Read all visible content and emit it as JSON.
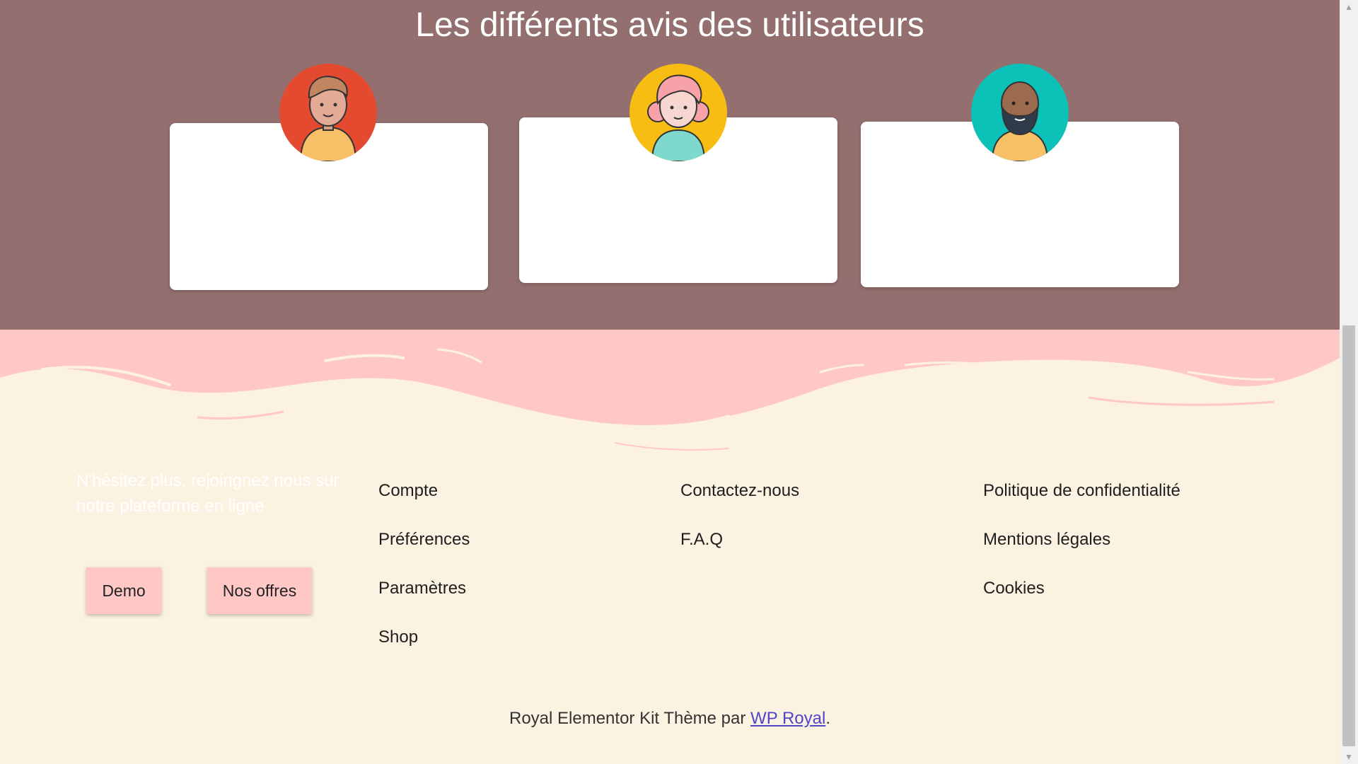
{
  "testimonials": {
    "title": "Les différents avis des utilisateurs",
    "cards": [
      {
        "accent": "#e44a2f",
        "avatar": "man-glasses-avatar-icon"
      },
      {
        "accent": "#f8bd13",
        "avatar": "woman-pink-hair-avatar-icon"
      },
      {
        "accent": "#0cc1b7",
        "avatar": "bearded-man-avatar-icon"
      }
    ]
  },
  "footer": {
    "cta_text": "N'hésitez plus, rejoingnez nous sur notre plateforme en ligne",
    "buttons": {
      "demo": "Demo",
      "offers": "Nos offres"
    },
    "col1": [
      "Compte",
      "Préférences",
      "Paramètres",
      "Shop"
    ],
    "col2": [
      "Contactez-nous",
      "F.A.Q"
    ],
    "col3": [
      "Politique de confidentialité",
      "Mentions légales",
      "Cookies"
    ],
    "credit_prefix": "Royal Elementor Kit Thème par ",
    "credit_link": "WP Royal",
    "credit_suffix": "."
  },
  "colors": {
    "testimonial_bg": "#93706f",
    "wave_pink": "#ffc8c7",
    "footer_bg": "#fcf2e2",
    "button_bg": "#ffc8c7",
    "link_blue": "#5046c8"
  }
}
